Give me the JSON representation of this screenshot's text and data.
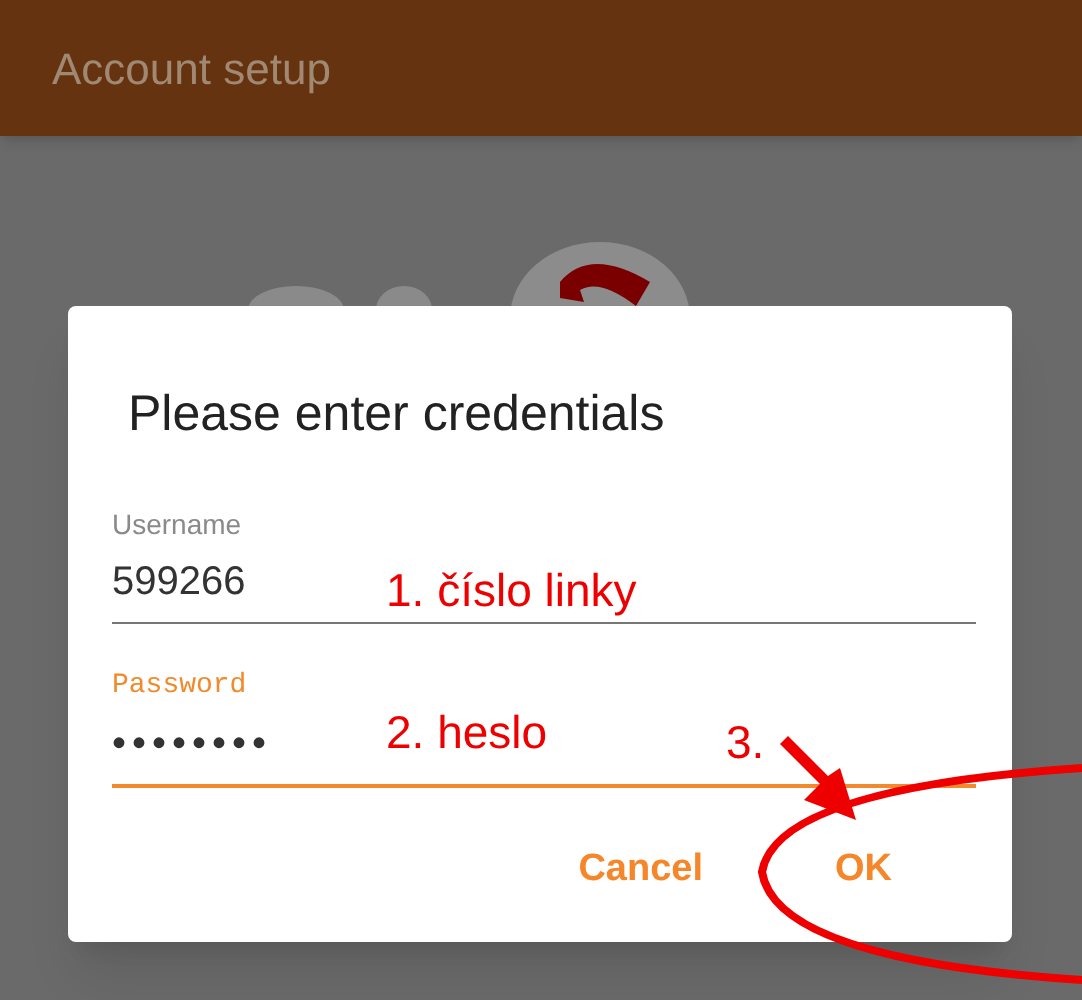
{
  "app_bar": {
    "title": "Account setup"
  },
  "dialog": {
    "title": "Please enter credentials",
    "fields": [
      {
        "label": "Username",
        "value": "599266",
        "focused": false
      },
      {
        "label": "Password",
        "value": "••••••••",
        "focused": true
      }
    ],
    "buttons": [
      "Cancel",
      "OK"
    ]
  },
  "annotations": [
    {
      "text": "1. číslo linky"
    },
    {
      "text": "2. heslo"
    },
    {
      "text": "3."
    }
  ]
}
